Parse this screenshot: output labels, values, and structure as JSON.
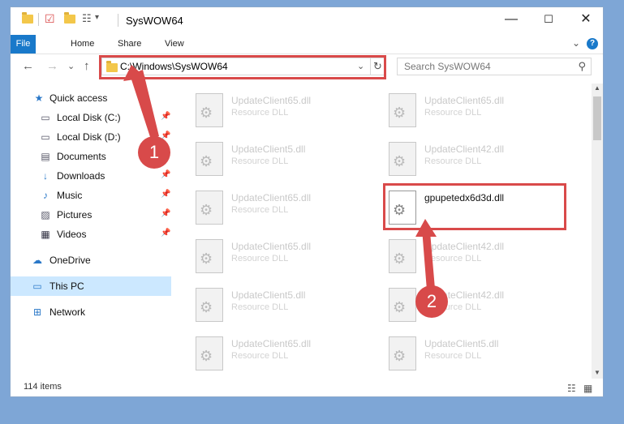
{
  "window": {
    "title": "SysWOW64",
    "controls": {
      "minimize": "—",
      "maximize": "☐",
      "close": "✕"
    }
  },
  "ribbon": {
    "tabs": [
      "File",
      "Home",
      "Share",
      "View"
    ],
    "expand_icon": "⌄",
    "help_icon": "?"
  },
  "address_bar": {
    "path": "C:\\Windows\\SysWOW64",
    "dropdown_icon": "⌄",
    "refresh_icon": "↻"
  },
  "search": {
    "placeholder": "Search SysWOW64",
    "icon": "⚲"
  },
  "nav_buttons": {
    "back": "←",
    "forward": "→",
    "recent": "⌄",
    "up": "↑"
  },
  "nav_pane": {
    "items": [
      {
        "label": "Quick access",
        "icon": "★",
        "pinned": false
      },
      {
        "label": "Local Disk (C:)",
        "icon": "▭",
        "pinned": true
      },
      {
        "label": "Local Disk (D:)",
        "icon": "▭",
        "pinned": true
      },
      {
        "label": "Documents",
        "icon": "▤",
        "pinned": true
      },
      {
        "label": "Downloads",
        "icon": "↓",
        "pinned": true
      },
      {
        "label": "Music",
        "icon": "♪",
        "pinned": true
      },
      {
        "label": "Pictures",
        "icon": "▨",
        "pinned": true
      },
      {
        "label": "Videos",
        "icon": "▦",
        "pinned": true
      },
      {
        "label": "OneDrive",
        "icon": "☁",
        "pinned": false
      },
      {
        "label": "This PC",
        "icon": "▭",
        "pinned": false
      },
      {
        "label": "Network",
        "icon": "⊞",
        "pinned": false
      }
    ],
    "pin_icon": "📌"
  },
  "files": [
    {
      "name": "UpdateClient65.dll",
      "type": "Resource DLL"
    },
    {
      "name": "UpdateClient65.dll",
      "type": "Resource DLL"
    },
    {
      "name": "UpdateClient5.dll",
      "type": "Resource DLL"
    },
    {
      "name": "UpdateClient42.dll",
      "type": "Resource DLL"
    },
    {
      "name": "UpdateClient65.dll",
      "type": "Resource DLL"
    },
    {
      "name": "gpupetedx6d3d.dll",
      "type": ""
    },
    {
      "name": "UpdateClient65.dll",
      "type": "Resource DLL"
    },
    {
      "name": "UpdateClient42.dll",
      "type": "Resource DLL"
    },
    {
      "name": "UpdateClient5.dll",
      "type": "Resource DLL"
    },
    {
      "name": "UpdateClient42.dll",
      "type": "Resource DLL"
    },
    {
      "name": "UpdateClient65.dll",
      "type": "Resource DLL"
    },
    {
      "name": "UpdateClient5.dll",
      "type": "Resource DLL"
    }
  ],
  "status": {
    "item_count": "114 items"
  },
  "annotations": {
    "step1": "1",
    "step2": "2",
    "color": "#d84a4a"
  }
}
